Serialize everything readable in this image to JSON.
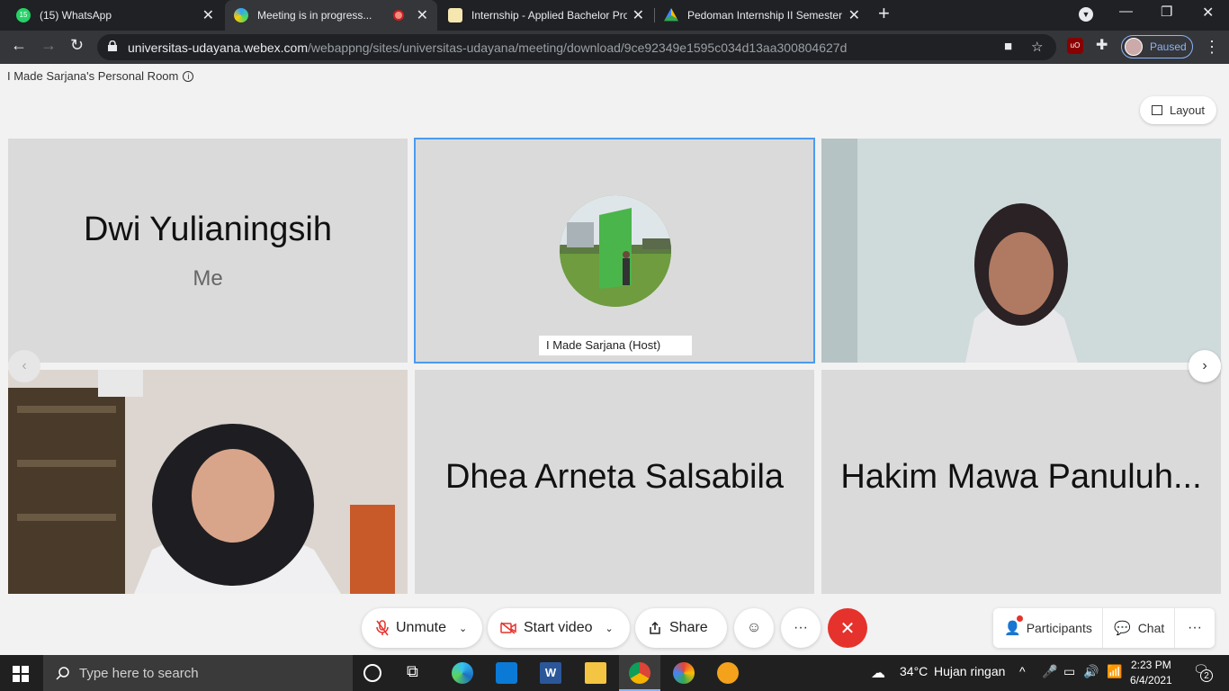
{
  "browser": {
    "tabs": [
      {
        "title": "(15) WhatsApp",
        "badge": "15",
        "active": false
      },
      {
        "title": "Meeting is in progress...",
        "active": true
      },
      {
        "title": "Internship - Applied Bachelor Pro",
        "active": false
      },
      {
        "title": "Pedoman Internship II Semester G",
        "active": false
      }
    ],
    "url_host": "universitas-udayana.webex.com",
    "url_path": "/webappng/sites/universitas-udayana/meeting/download/9ce92349e1595c034d13aa300804627d",
    "profile_label": "Paused"
  },
  "meeting": {
    "room_title": "I Made Sarjana's Personal Room",
    "layout_label": "Layout",
    "tiles": [
      {
        "name": "Dwi Yulianingsih",
        "sub": "Me"
      },
      {
        "name": "I Made Sarjana (Host)"
      },
      {
        "name": ""
      },
      {
        "name": ""
      },
      {
        "name": "Dhea Arneta Salsabila"
      },
      {
        "name": "Hakim Mawa Panuluh..."
      }
    ],
    "controls": {
      "unmute": "Unmute",
      "start_video": "Start video",
      "share": "Share",
      "participants": "Participants",
      "chat": "Chat"
    }
  },
  "taskbar": {
    "search_placeholder": "Type here to search",
    "weather_temp": "34°C",
    "weather_desc": "Hujan ringan",
    "time": "2:23 PM",
    "date": "6/4/2021",
    "notification_count": "2"
  },
  "colors": {
    "host_border": "#4a9cf0",
    "end_button": "#e6322c",
    "tile_bg": "#dadada"
  }
}
